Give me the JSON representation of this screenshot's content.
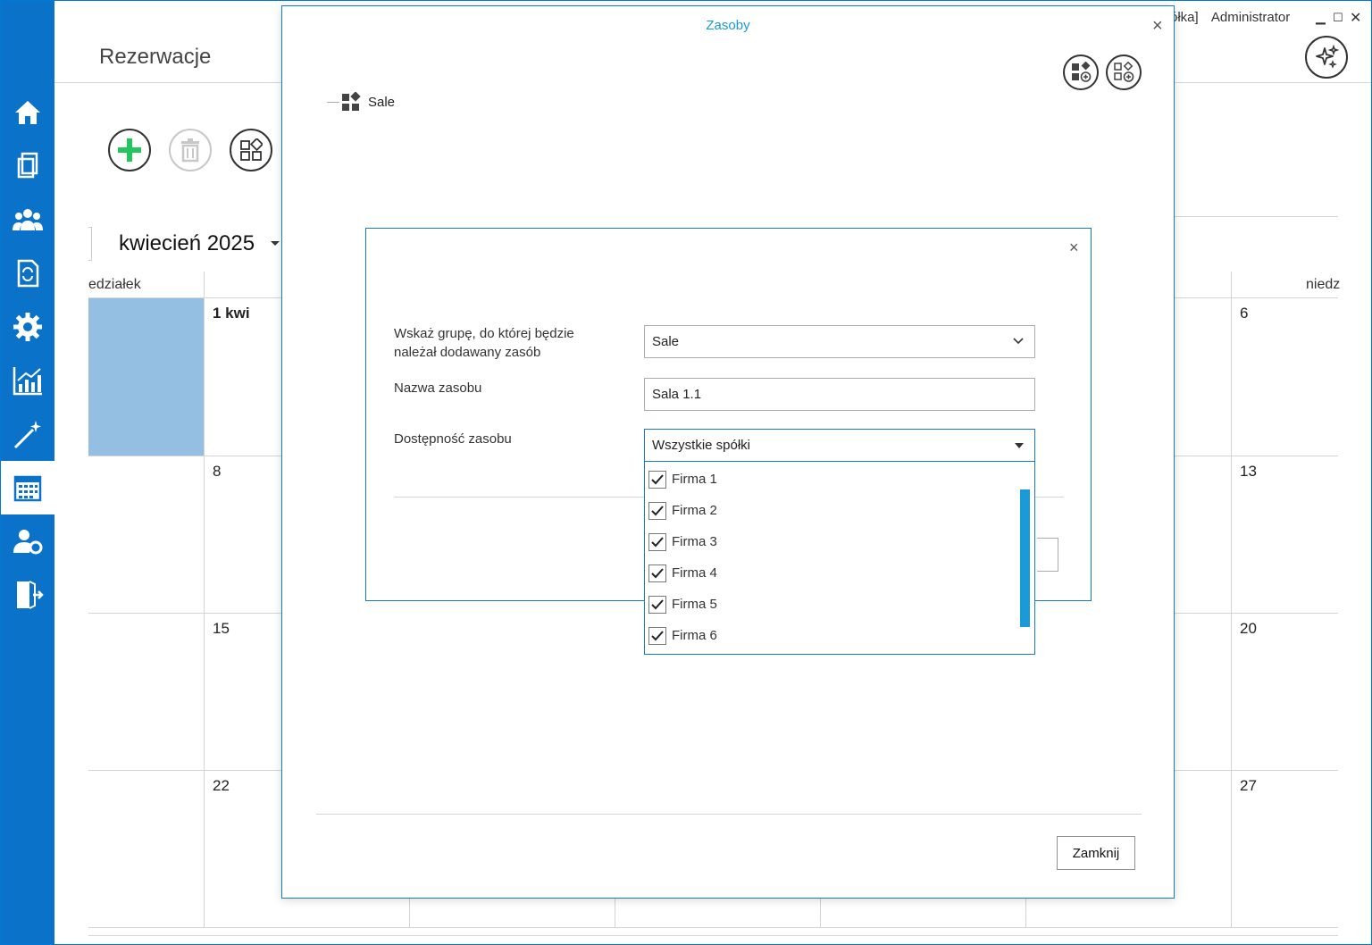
{
  "app": {
    "title": "Rezerwacje",
    "company_fragment": "ółka]",
    "user": "Administrator"
  },
  "sidebar": {
    "items": [
      {
        "icon": "home-icon"
      },
      {
        "icon": "documents-icon"
      },
      {
        "icon": "users-icon"
      },
      {
        "icon": "workflow-document-icon"
      },
      {
        "icon": "gear-icon"
      },
      {
        "icon": "chart-icon"
      },
      {
        "icon": "magic-wand-icon"
      },
      {
        "icon": "calendar-icon",
        "active": true
      },
      {
        "icon": "user-settings-icon"
      },
      {
        "icon": "logout-icon"
      }
    ]
  },
  "toolbar": {
    "add": "plus-icon",
    "delete": "trash-icon",
    "resources": "resources-icon"
  },
  "calendar": {
    "month": "kwiecień 2025",
    "day_headers": {
      "left": "edziałek",
      "right": "niedz"
    },
    "days": {
      "r1c1": "1 kwi",
      "r1c7": "6",
      "r2c1": "8",
      "r2c7": "13",
      "r3c1": "15",
      "r3c7": "20",
      "r4c1": "22",
      "r4c7": "27"
    }
  },
  "zasoby_dialog": {
    "title": "Zasoby",
    "tree": {
      "root": "Sale"
    },
    "close_label": "Zamknij"
  },
  "add_resource_dialog": {
    "group_label": "Wskaż grupę, do której będzie należał dodawany zasób",
    "group_value": "Sale",
    "name_label": "Nazwa zasobu",
    "name_value": "Sala 1.1",
    "availability_label": "Dostępność zasobu",
    "availability_value": "Wszystkie spółki",
    "companies": [
      {
        "name": "Firma 1",
        "checked": true
      },
      {
        "name": "Firma 2",
        "checked": true
      },
      {
        "name": "Firma 3",
        "checked": true
      },
      {
        "name": "Firma 4",
        "checked": true
      },
      {
        "name": "Firma 5",
        "checked": true
      },
      {
        "name": "Firma 6",
        "checked": true
      }
    ]
  },
  "colors": {
    "sidebar": "#0a72c8",
    "accent": "#1a7abf",
    "title_blue": "#1a9bd7",
    "selected_day": "#94bfe2",
    "add_green": "#22c55e"
  }
}
